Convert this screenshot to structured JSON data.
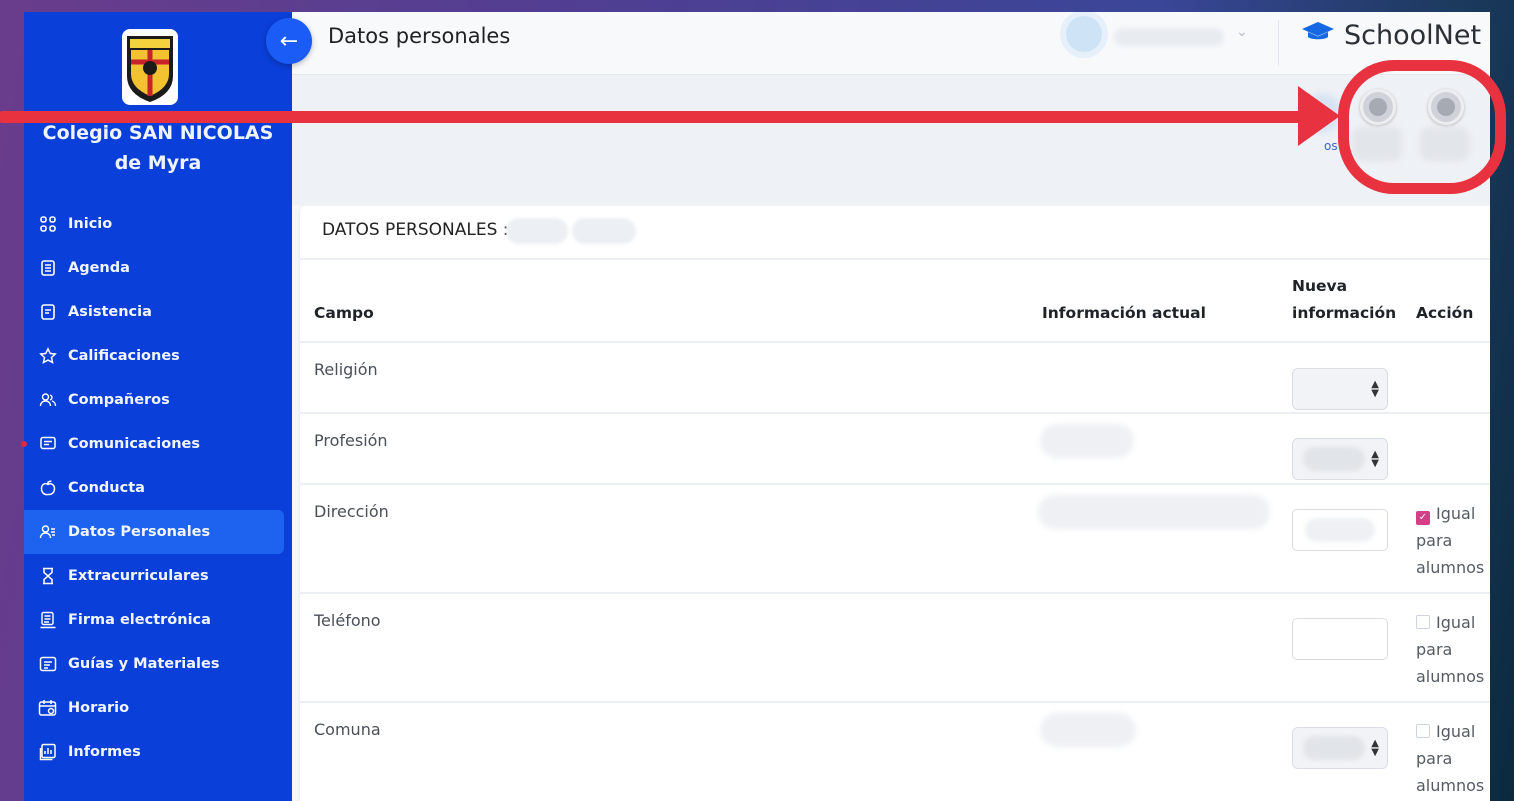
{
  "sidebar": {
    "school_name": "Colegio SAN NICOLAS de Myra",
    "logo_text": "SAN NICOLAS",
    "items": [
      {
        "label": "Inicio",
        "icon": "grid-icon"
      },
      {
        "label": "Agenda",
        "icon": "agenda-icon"
      },
      {
        "label": "Asistencia",
        "icon": "clipboard-icon"
      },
      {
        "label": "Calificaciones",
        "icon": "star-icon"
      },
      {
        "label": "Compañeros",
        "icon": "users-icon"
      },
      {
        "label": "Comunicaciones",
        "icon": "message-icon"
      },
      {
        "label": "Conducta",
        "icon": "apple-icon"
      },
      {
        "label": "Datos Personales",
        "icon": "user-card-icon",
        "active": true
      },
      {
        "label": "Extracurriculares",
        "icon": "hourglass-icon"
      },
      {
        "label": "Firma electrónica",
        "icon": "signature-icon"
      },
      {
        "label": "Guías y Materiales",
        "icon": "folder-icon"
      },
      {
        "label": "Horario",
        "icon": "calendar-icon"
      },
      {
        "label": "Informes",
        "icon": "report-icon"
      }
    ]
  },
  "header": {
    "title": "Datos personales",
    "brand": "SchoolNet"
  },
  "subheader": {
    "partial_link": "os"
  },
  "card": {
    "title": "DATOS PERSONALES :",
    "columns": {
      "campo": "Campo",
      "actual": "Información actual",
      "nueva_1": "Nueva",
      "nueva_2": "información",
      "accion": "Acción"
    },
    "rows": [
      {
        "campo": "Religión",
        "input": "select",
        "has_action": false
      },
      {
        "campo": "Profesión",
        "input": "select",
        "has_action": false
      },
      {
        "campo": "Dirección",
        "input": "text",
        "has_action": true,
        "checked": true
      },
      {
        "campo": "Teléfono",
        "input": "text",
        "has_action": true,
        "checked": false
      },
      {
        "campo": "Comuna",
        "input": "select",
        "has_action": true,
        "checked": false
      }
    ],
    "action_label": {
      "l1": "Igual",
      "l2": "para",
      "l3": "alumnos"
    }
  },
  "colors": {
    "sidebar": "#0a3fd9",
    "active_item": "#1d63f0",
    "annotation": "#e8323f",
    "checkbox_checked": "#d23f86"
  }
}
